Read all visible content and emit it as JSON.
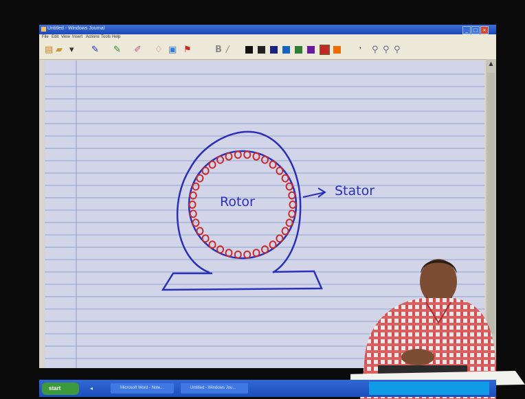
{
  "window": {
    "title": "Untitled - Windows Journal",
    "menu": [
      "File",
      "Edit",
      "View",
      "Insert",
      "Actions",
      "Tools",
      "Help"
    ]
  },
  "toolbar": {
    "swatches": [
      "#111111",
      "#222222",
      "#1a237e",
      "#1565c0",
      "#2e7d32",
      "#6a1b9a",
      "#c62828",
      "#ef6c00"
    ],
    "icons": [
      "new-page-icon",
      "open-icon",
      "pen-icon",
      "highlighter-icon",
      "eraser-icon",
      "lasso-icon",
      "insert-space-icon",
      "flag-icon",
      "bold-icon",
      "italic-icon",
      "zoom-icon"
    ]
  },
  "note": {
    "rotor_label": "Rotor",
    "stator_label": "Stator",
    "pen_color": "#2a2fb8",
    "coil_color": "#c92c2c",
    "paper_color": "#d2d4e8",
    "rule_color": "#8da6d2"
  },
  "taskbar": {
    "start_label": "start",
    "tasks": [
      "Microsoft Word - Note...",
      "Untitled - Windows Jou..."
    ]
  }
}
